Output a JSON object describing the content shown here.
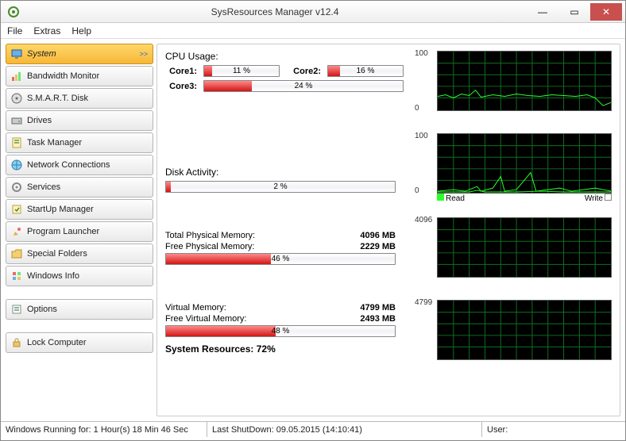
{
  "window": {
    "title": "SysResources Manager  v12.4"
  },
  "menu": {
    "file": "File",
    "extras": "Extras",
    "help": "Help"
  },
  "sidebar": {
    "items": [
      {
        "label": "System"
      },
      {
        "label": "Bandwidth Monitor"
      },
      {
        "label": "S.M.A.R.T. Disk"
      },
      {
        "label": "Drives"
      },
      {
        "label": "Task Manager"
      },
      {
        "label": "Network Connections"
      },
      {
        "label": "Services"
      },
      {
        "label": "StartUp Manager"
      },
      {
        "label": "Program Launcher"
      },
      {
        "label": "Special Folders"
      },
      {
        "label": "Windows Info"
      },
      {
        "label": "Options"
      },
      {
        "label": "Lock Computer"
      }
    ]
  },
  "cpu": {
    "title": "CPU Usage:",
    "cores": [
      {
        "name": "Core1:",
        "pct": 11,
        "text": "11 %"
      },
      {
        "name": "Core2:",
        "pct": 16,
        "text": "16 %"
      },
      {
        "name": "Core3:",
        "pct": 24,
        "text": "24 %"
      }
    ],
    "ymax": "100",
    "ymin": "0"
  },
  "disk": {
    "title": "Disk Activity:",
    "pct": 2,
    "text": "2 %",
    "legend": {
      "read": "Read",
      "write": "Write"
    },
    "ymax": "100",
    "ymin": "0"
  },
  "physmem": {
    "totalLabel": "Total Physical Memory:",
    "totalVal": "4096 MB",
    "freeLabel": "Free Physical Memory:",
    "freeVal": "2229 MB",
    "pct": 46,
    "text": "46 %",
    "ymax": "4096"
  },
  "virtmem": {
    "totalLabel": "Virtual Memory:",
    "totalVal": "4799 MB",
    "freeLabel": "Free Virtual Memory:",
    "freeVal": "2493 MB",
    "pct": 48,
    "text": "48 %",
    "ymax": "4799"
  },
  "summary": "System Resources: 72%",
  "status": {
    "running": "Windows Running for: 1 Hour(s) 18 Min 46 Sec",
    "shutdown": "Last ShutDown: 09.05.2015 (14:10:41)",
    "user": "User:"
  }
}
